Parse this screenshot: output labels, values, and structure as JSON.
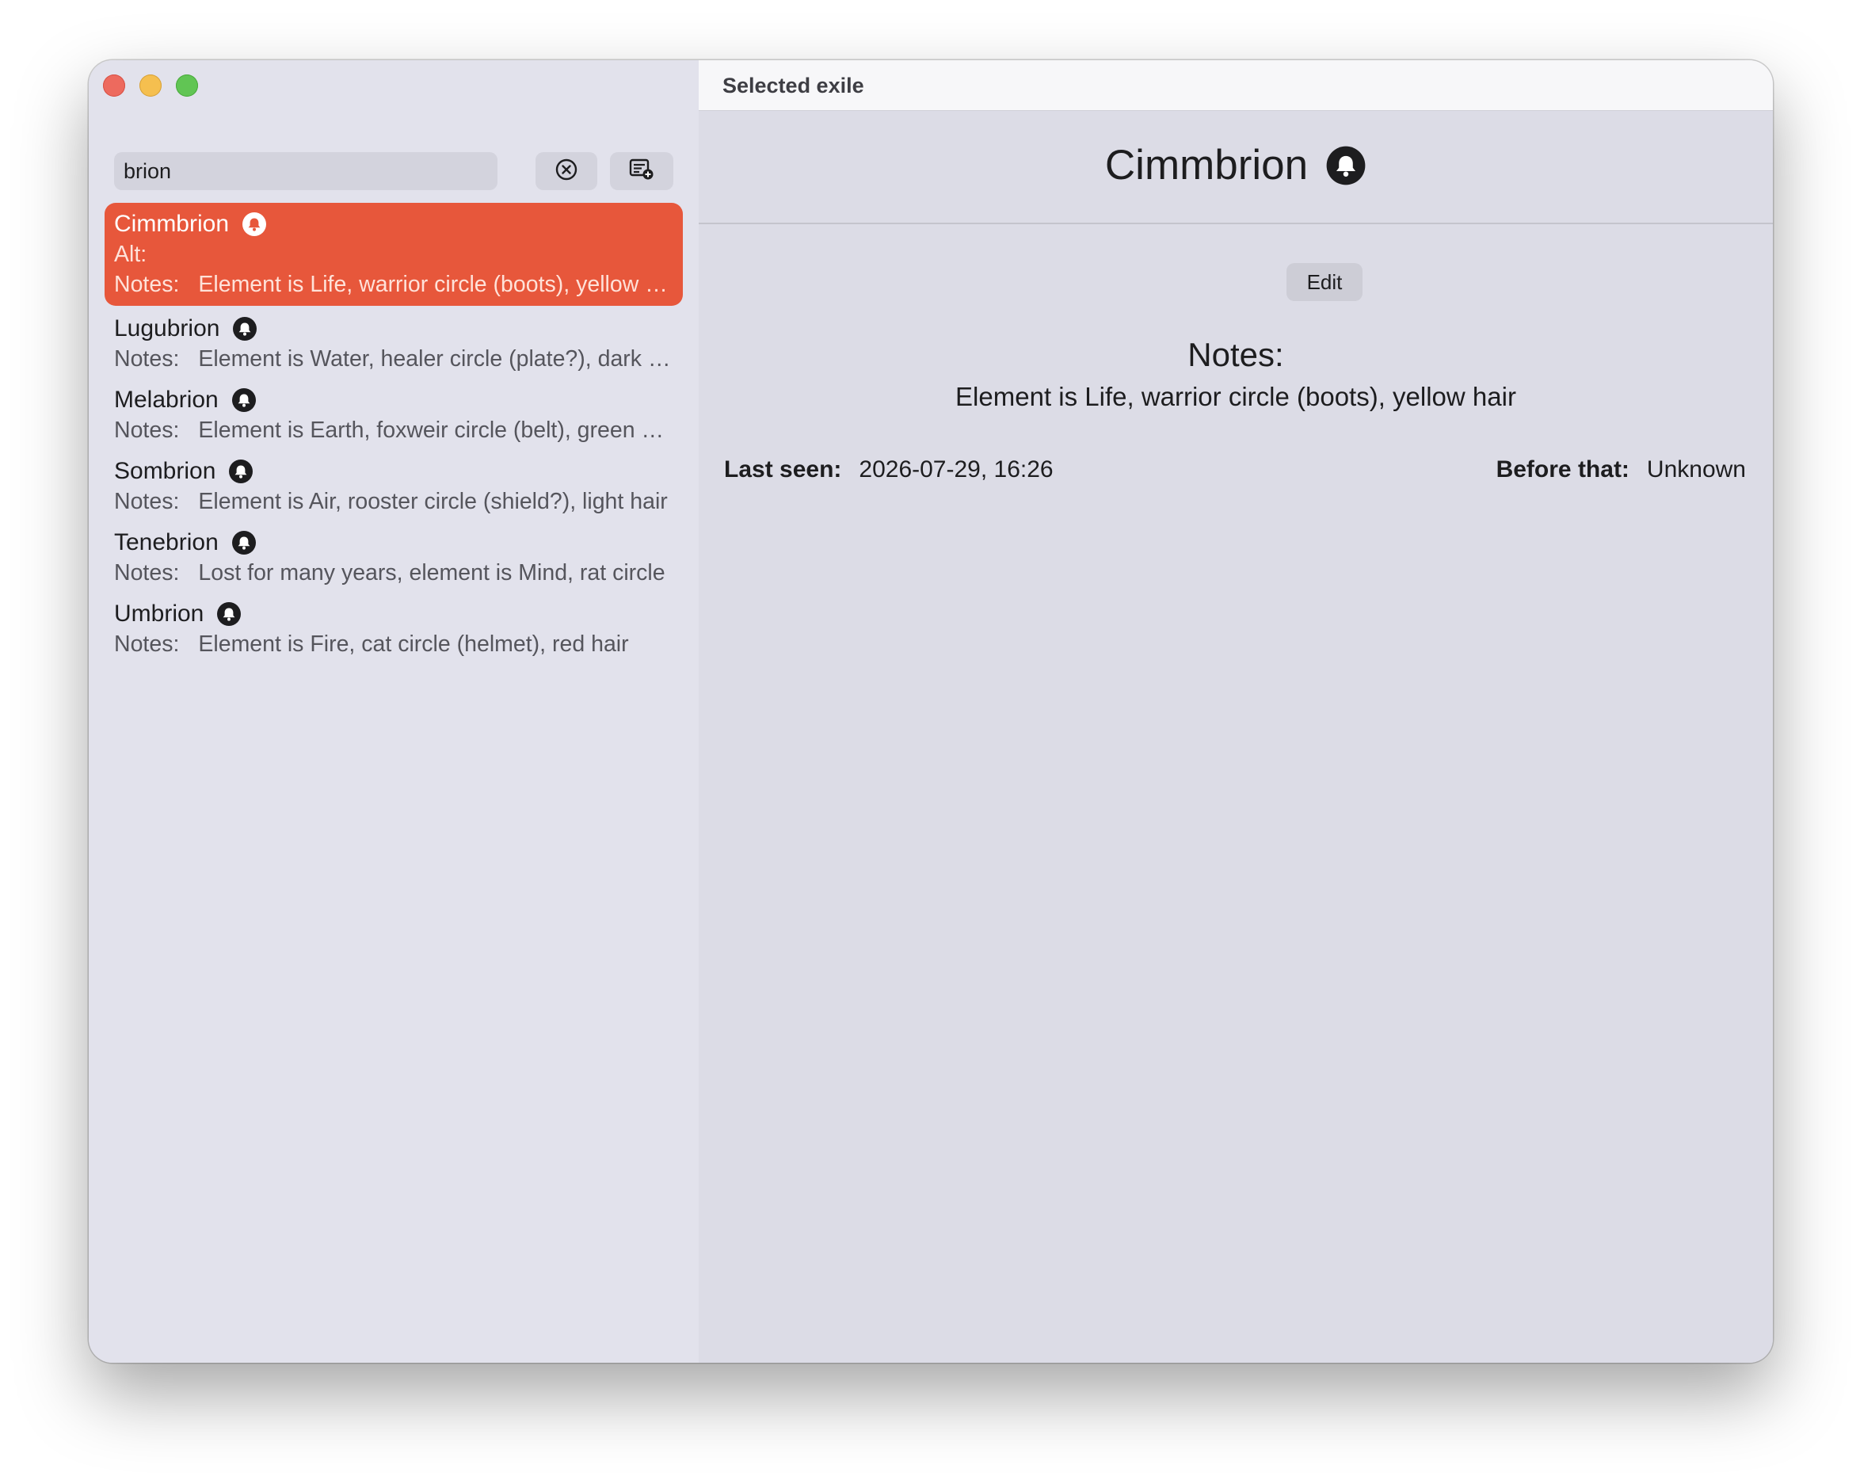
{
  "window": {
    "controls": {
      "close": "close",
      "minimize": "minimize",
      "maximize": "maximize"
    },
    "title": "Selected exile"
  },
  "sidebar": {
    "search": {
      "value": "brion",
      "placeholder": ""
    },
    "clear_icon": "clear-circle-icon",
    "new_list_icon": "list-add-icon",
    "items": [
      {
        "name": "Cimmbrion",
        "alt_label": "Alt:",
        "alt_value": "",
        "notes_label": "Notes:",
        "notes": "Element is Life, warrior circle (boots), yellow hair",
        "selected": true
      },
      {
        "name": "Lugubrion",
        "notes_label": "Notes:",
        "notes": "Element is Water, healer circle (plate?), dark hair"
      },
      {
        "name": "Melabrion",
        "notes_label": "Notes:",
        "notes": "Element is Earth, foxweir circle (belt), green hair"
      },
      {
        "name": "Sombrion",
        "notes_label": "Notes:",
        "notes": "Element is Air, rooster circle (shield?), light hair"
      },
      {
        "name": "Tenebrion",
        "notes_label": "Notes:",
        "notes": "Lost for many years, element is Mind, rat circle"
      },
      {
        "name": "Umbrion",
        "notes_label": "Notes:",
        "notes": "Element is Fire, cat circle (helmet), red hair"
      }
    ]
  },
  "detail": {
    "name": "Cimmbrion",
    "edit_label": "Edit",
    "notes_label": "Notes:",
    "notes": "Element is Life, warrior circle (boots), yellow hair",
    "last_seen_label": "Last seen:",
    "last_seen_value": "2026-07-29, 16:26",
    "before_label": "Before that:",
    "before_value": "Unknown"
  },
  "colors": {
    "accent": "#e7573b",
    "sidebar_bg": "#e2e2ec",
    "detail_bg": "#dcdce6"
  }
}
